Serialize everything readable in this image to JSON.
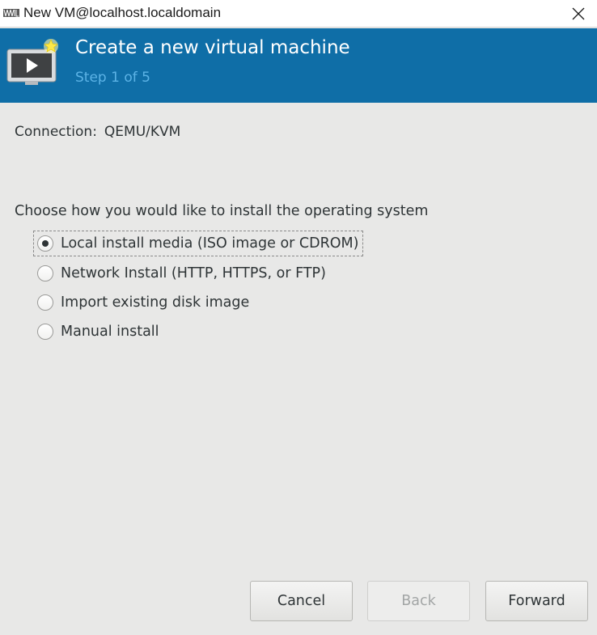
{
  "window": {
    "title": "New VM@localhost.localdomain",
    "icons": {
      "app": "virt-manager-icon",
      "close": "close-icon"
    }
  },
  "header": {
    "title": "Create a new virtual machine",
    "step": "Step 1 of 5",
    "icon": "new-vm-monitor-icon",
    "background_color": "#0f6ea7",
    "step_color": "#5cb3e6"
  },
  "connection": {
    "label": "Connection:",
    "value": "QEMU/KVM"
  },
  "install": {
    "prompt": "Choose how you would like to install the operating system",
    "options": [
      {
        "label": "Local install media (ISO image or CDROM)",
        "selected": true
      },
      {
        "label": "Network Install (HTTP, HTTPS, or FTP)",
        "selected": false
      },
      {
        "label": "Import existing disk image",
        "selected": false
      },
      {
        "label": "Manual install",
        "selected": false
      }
    ]
  },
  "buttons": {
    "cancel": "Cancel",
    "back": "Back",
    "back_enabled": false,
    "forward": "Forward"
  }
}
